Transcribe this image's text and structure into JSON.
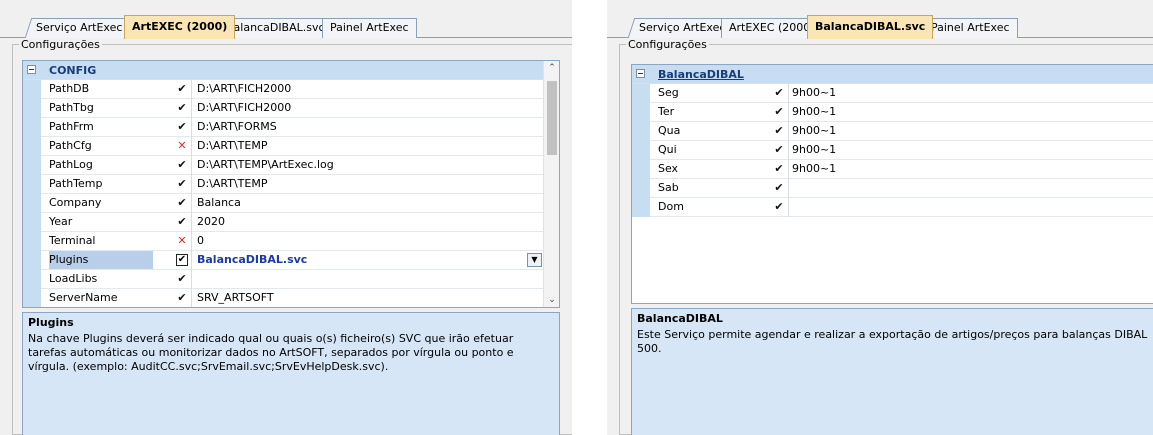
{
  "left": {
    "tabs": [
      {
        "label": "Serviço ArtExec"
      },
      {
        "label": "ArtEXEC (2000)"
      },
      {
        "label": "BalancaDIBAL.svc"
      },
      {
        "label": "Painel ArtExec"
      }
    ],
    "group_title": "Configurações",
    "category": "CONFIG",
    "rows": [
      {
        "name": "PathDB",
        "check": "✔",
        "status": "ok",
        "value": "D:\\ART\\FICH2000"
      },
      {
        "name": "PathTbg",
        "check": "✔",
        "status": "ok",
        "value": "D:\\ART\\FICH2000"
      },
      {
        "name": "PathFrm",
        "check": "✔",
        "status": "ok",
        "value": "D:\\ART\\FORMS"
      },
      {
        "name": "PathCfg",
        "check": "✕",
        "status": "bad",
        "value": "D:\\ART\\TEMP"
      },
      {
        "name": "PathLog",
        "check": "✔",
        "status": "ok",
        "value": "D:\\ART\\TEMP\\ArtExec.log"
      },
      {
        "name": "PathTemp",
        "check": "✔",
        "status": "ok",
        "value": "D:\\ART\\TEMP"
      },
      {
        "name": "Company",
        "check": "✔",
        "status": "ok",
        "value": "Balanca"
      },
      {
        "name": "Year",
        "check": "✔",
        "status": "ok",
        "value": "2020"
      },
      {
        "name": "Terminal",
        "check": "✕",
        "status": "bad",
        "value": "0"
      },
      {
        "name": "Plugins",
        "check": "✔",
        "status": "checkbox",
        "value": "BalancaDIBAL.svc"
      },
      {
        "name": "LoadLibs",
        "check": "✔",
        "status": "ok",
        "value": ""
      },
      {
        "name": "ServerName",
        "check": "✔",
        "status": "ok",
        "value": "SRV_ARTSOFT"
      }
    ],
    "desc_title": "Plugins",
    "desc_text": "Na chave Plugins deverá ser indicado qual ou quais o(s) ficheiro(s) SVC que irão efetuar tarefas automáticas ou monitorizar dados no ArtSOFT, separados por vírgula ou ponto e vírgula. (exemplo: AuditCC.svc;SrvEmail.svc;SrvEvHelpDesk.svc)."
  },
  "right": {
    "tabs": [
      {
        "label": "Serviço ArtExec"
      },
      {
        "label": "ArtEXEC (2000)"
      },
      {
        "label": "BalancaDIBAL.svc"
      },
      {
        "label": "Painel ArtExec"
      }
    ],
    "group_title": "Configurações",
    "category": "BalancaDIBAL",
    "rows": [
      {
        "name": "Seg",
        "check": "✔",
        "status": "ok",
        "value": "9h00~1"
      },
      {
        "name": "Ter",
        "check": "✔",
        "status": "ok",
        "value": "9h00~1"
      },
      {
        "name": "Qua",
        "check": "✔",
        "status": "ok",
        "value": "9h00~1"
      },
      {
        "name": "Qui",
        "check": "✔",
        "status": "ok",
        "value": "9h00~1"
      },
      {
        "name": "Sex",
        "check": "✔",
        "status": "ok",
        "value": "9h00~1"
      },
      {
        "name": "Sab",
        "check": "✔",
        "status": "ok",
        "value": ""
      },
      {
        "name": "Dom",
        "check": "✔",
        "status": "ok",
        "value": ""
      }
    ],
    "desc_title": "BalancaDIBAL",
    "desc_text": "Este Serviço permite agendar e realizar a exportação de artigos/preços para balanças DIBAL 500."
  }
}
